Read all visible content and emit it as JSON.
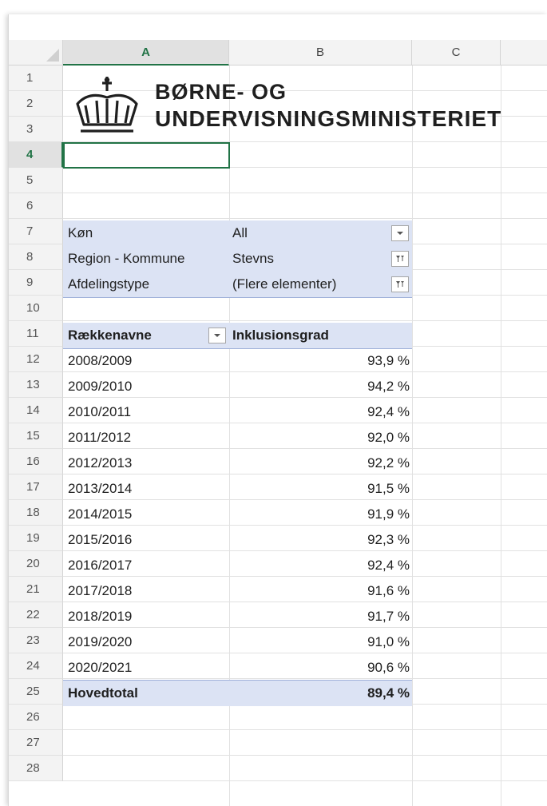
{
  "columns": {
    "a": "A",
    "b": "B",
    "c": "C"
  },
  "rows": [
    "1",
    "2",
    "3",
    "4",
    "5",
    "6",
    "7",
    "8",
    "9",
    "10",
    "11",
    "12",
    "13",
    "14",
    "15",
    "16",
    "17",
    "18",
    "19",
    "20",
    "21",
    "22",
    "23",
    "24",
    "25",
    "26",
    "27",
    "28"
  ],
  "logo": {
    "line1": "BØRNE- OG",
    "line2": "UNDERVISNINGSMINISTERIET"
  },
  "filters": [
    {
      "label": "Køn",
      "value": "All"
    },
    {
      "label": "Region - Kommune",
      "value": "Stevns"
    },
    {
      "label": "Afdelingstype",
      "value": "(Flere elementer)"
    }
  ],
  "pivot": {
    "row_header": "Rækkenavne",
    "value_header": "Inklusionsgrad",
    "rows": [
      {
        "label": "2008/2009",
        "value": "93,9 %"
      },
      {
        "label": "2009/2010",
        "value": "94,2 %"
      },
      {
        "label": "2010/2011",
        "value": "92,4 %"
      },
      {
        "label": "2011/2012",
        "value": "92,0 %"
      },
      {
        "label": "2012/2013",
        "value": "92,2 %"
      },
      {
        "label": "2013/2014",
        "value": "91,5 %"
      },
      {
        "label": "2014/2015",
        "value": "91,9 %"
      },
      {
        "label": "2015/2016",
        "value": "92,3 %"
      },
      {
        "label": "2016/2017",
        "value": "92,4 %"
      },
      {
        "label": "2017/2018",
        "value": "91,6 %"
      },
      {
        "label": "2018/2019",
        "value": "91,7 %"
      },
      {
        "label": "2019/2020",
        "value": "91,0 %"
      },
      {
        "label": "2020/2021",
        "value": "90,6 %"
      }
    ],
    "total_label": "Hovedtotal",
    "total_value": "89,4 %"
  },
  "selected_cell": "A4",
  "colors": {
    "accent": "#217346",
    "pivot_band": "#dce3f4"
  }
}
